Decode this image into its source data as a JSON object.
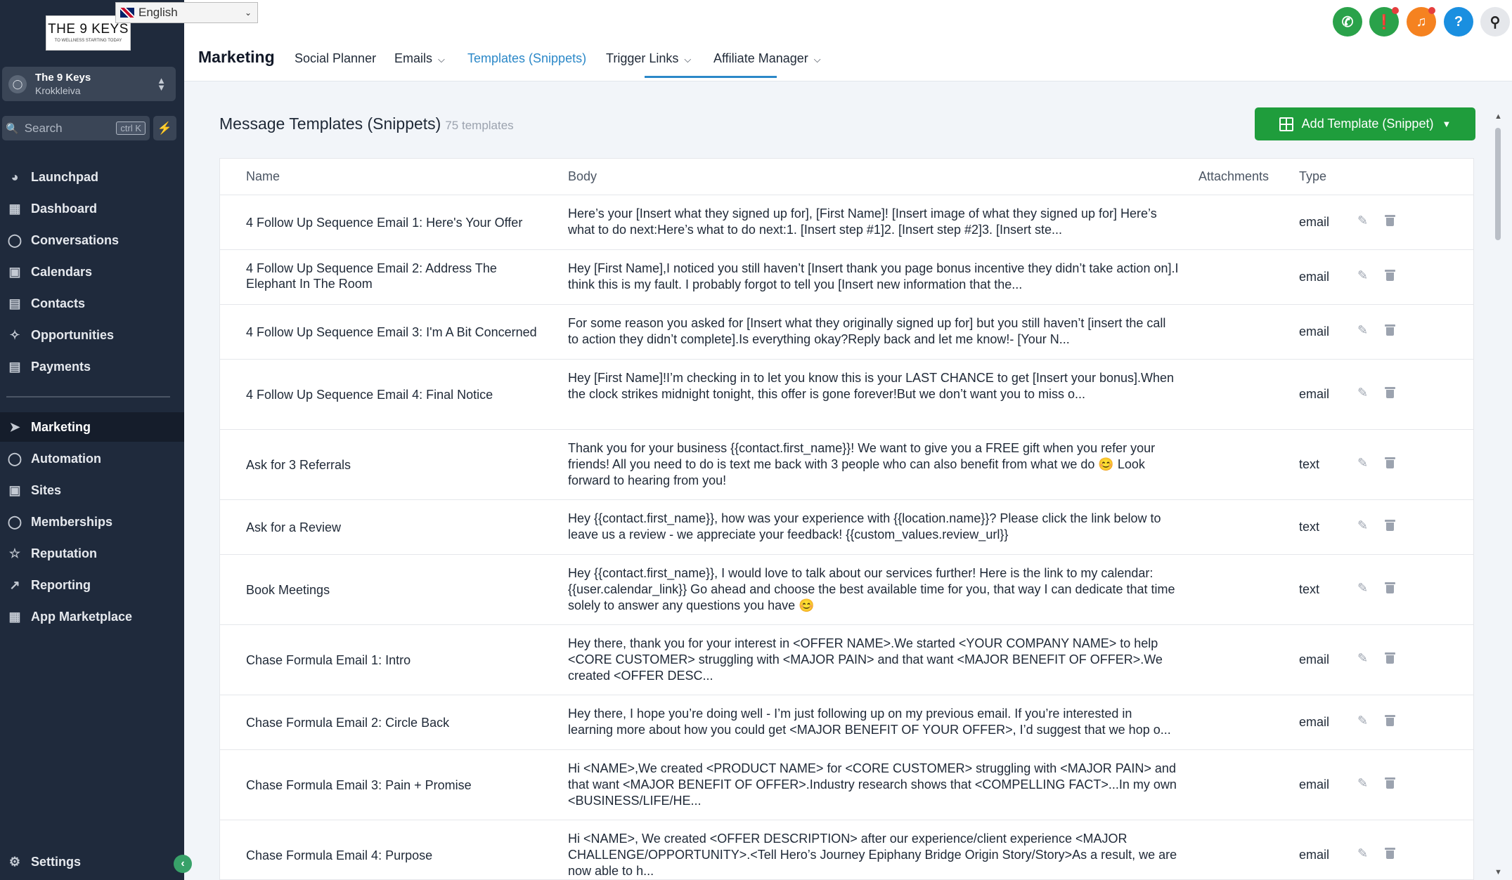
{
  "sidebar": {
    "logo_line1": "THE 9 KEYS",
    "logo_line2": "TO WELLNESS STARTING TODAY",
    "language": "English",
    "account": {
      "name": "The 9 Keys",
      "sub": "Krokkleiva"
    },
    "search": {
      "placeholder": "Search",
      "shortcut": "ctrl K"
    },
    "nav": [
      {
        "label": "Launchpad",
        "icon": "launchpad-icon"
      },
      {
        "label": "Dashboard",
        "icon": "dashboard-icon"
      },
      {
        "label": "Conversations",
        "icon": "chat-icon"
      },
      {
        "label": "Calendars",
        "icon": "calendar-icon"
      },
      {
        "label": "Contacts",
        "icon": "contacts-icon"
      },
      {
        "label": "Opportunities",
        "icon": "opportunities-icon"
      },
      {
        "label": "Payments",
        "icon": "payments-icon"
      },
      {
        "label": "Marketing",
        "icon": "send-icon",
        "active": true
      },
      {
        "label": "Automation",
        "icon": "automation-icon"
      },
      {
        "label": "Sites",
        "icon": "sites-icon"
      },
      {
        "label": "Memberships",
        "icon": "memberships-icon"
      },
      {
        "label": "Reputation",
        "icon": "star-icon"
      },
      {
        "label": "Reporting",
        "icon": "chart-icon"
      },
      {
        "label": "App Marketplace",
        "icon": "apps-icon"
      }
    ],
    "settings": "Settings"
  },
  "header": {
    "title": "Marketing",
    "tabs": [
      {
        "label": "Social Planner",
        "dropdown": false
      },
      {
        "label": "Emails",
        "dropdown": true
      },
      {
        "label": "Templates (Snippets)",
        "dropdown": false,
        "active": true
      },
      {
        "label": "Trigger Links",
        "dropdown": true
      },
      {
        "label": "Affiliate Manager",
        "dropdown": true
      }
    ],
    "icon_colors": {
      "phone": "#2aa24a",
      "megaphone": "#2aa24a",
      "bell": "#f58220",
      "help": "#1a8fe0",
      "key": "#e5e7eb"
    }
  },
  "main": {
    "title": "Message Templates (Snippets)",
    "count": "75 templates",
    "add_button": "Add Template (Snippet)",
    "columns": [
      "Name",
      "Body",
      "Attachments",
      "Type"
    ],
    "rows": [
      {
        "name": "4 Follow Up Sequence Email 1: Here's Your Offer",
        "body": "Here’s your [Insert what they signed up for], [First Name]! [Insert image of what they signed up for] Here’s what to do next:Here’s what to do next:1. [Insert step #1]2. [Insert step #2]3. [Insert ste...",
        "type": "email"
      },
      {
        "name": "4 Follow Up Sequence Email 2: Address The Elephant In The Room",
        "body": "Hey [First Name],I noticed you still haven’t [Insert thank you page bonus incentive they didn’t take action on].I think this is my fault. I probably forgot to tell you [Insert new information that the...",
        "type": "email"
      },
      {
        "name": "4 Follow Up Sequence Email 3: I'm A Bit Concerned",
        "body": "For some reason you asked for [Insert what they originally signed up for] but you still haven’t [insert the call to action they didn’t complete].Is everything okay?Reply back and let me know!- [Your N...",
        "type": "email"
      },
      {
        "name": "4 Follow Up Sequence Email 4: Final Notice",
        "body": "Hey [First Name]!I’m checking in to let you know this is your LAST CHANCE to get [Insert your bonus].When the clock strikes midnight tonight, this offer is gone forever!But we don’t want you to miss o...",
        "type": "email"
      },
      {
        "name": "Ask for 3 Referrals",
        "body": "Thank you for your business {{contact.first_name}}! We want to give you a FREE gift when you refer your friends!   All you need to do is text me back with 3 people who can also benefit from what we do 😊 Look forward to hearing from you!",
        "type": "text"
      },
      {
        "name": "Ask for a Review",
        "body": "Hey {{contact.first_name}}, how was your experience with {{location.name}}? Please click the link below to leave us a review - we appreciate your feedback! {{custom_values.review_url}}",
        "type": "text"
      },
      {
        "name": "Book Meetings",
        "body": "Hey {{contact.first_name}}, I would love to talk about our services further! Here is the link to my calendar: {{user.calendar_link}} Go ahead and choose the best available time for you, that way I can dedicate that time solely to answer any questions you have 😊",
        "type": "text"
      },
      {
        "name": "Chase Formula Email 1: Intro",
        "body": "Hey there, thank you for your interest in <OFFER NAME>.We started <YOUR COMPANY NAME> to help <CORE CUSTOMER> struggling with <MAJOR PAIN> and that want <MAJOR BENEFIT OF OFFER>.We created <OFFER DESC...",
        "type": "email"
      },
      {
        "name": "Chase Formula Email 2: Circle Back",
        "body": "Hey there, I hope you’re doing well - I’m just following up on my previous email. If you’re interested in learning more about how you could get <MAJOR BENEFIT OF YOUR OFFER>, I’d suggest that we hop o...",
        "type": "email"
      },
      {
        "name": "Chase Formula Email 3: Pain + Promise",
        "body": "Hi <NAME>,We created <PRODUCT NAME> for <CORE CUSTOMER> struggling with <MAJOR PAIN> and that want <MAJOR BENEFIT OF OFFER>.Industry research shows that <COMPELLING FACT>...In my own <BUSINESS/LIFE/HE...",
        "type": "email"
      },
      {
        "name": "Chase Formula Email 4: Purpose",
        "body": "Hi <NAME>, We created <OFFER DESCRIPTION> after our experience/client experience <MAJOR CHALLENGE/OPPORTUNITY>.<Tell Hero’s Journey Epiphany Bridge Origin Story/Story>As a result, we are now able to h...",
        "type": "email"
      }
    ]
  }
}
